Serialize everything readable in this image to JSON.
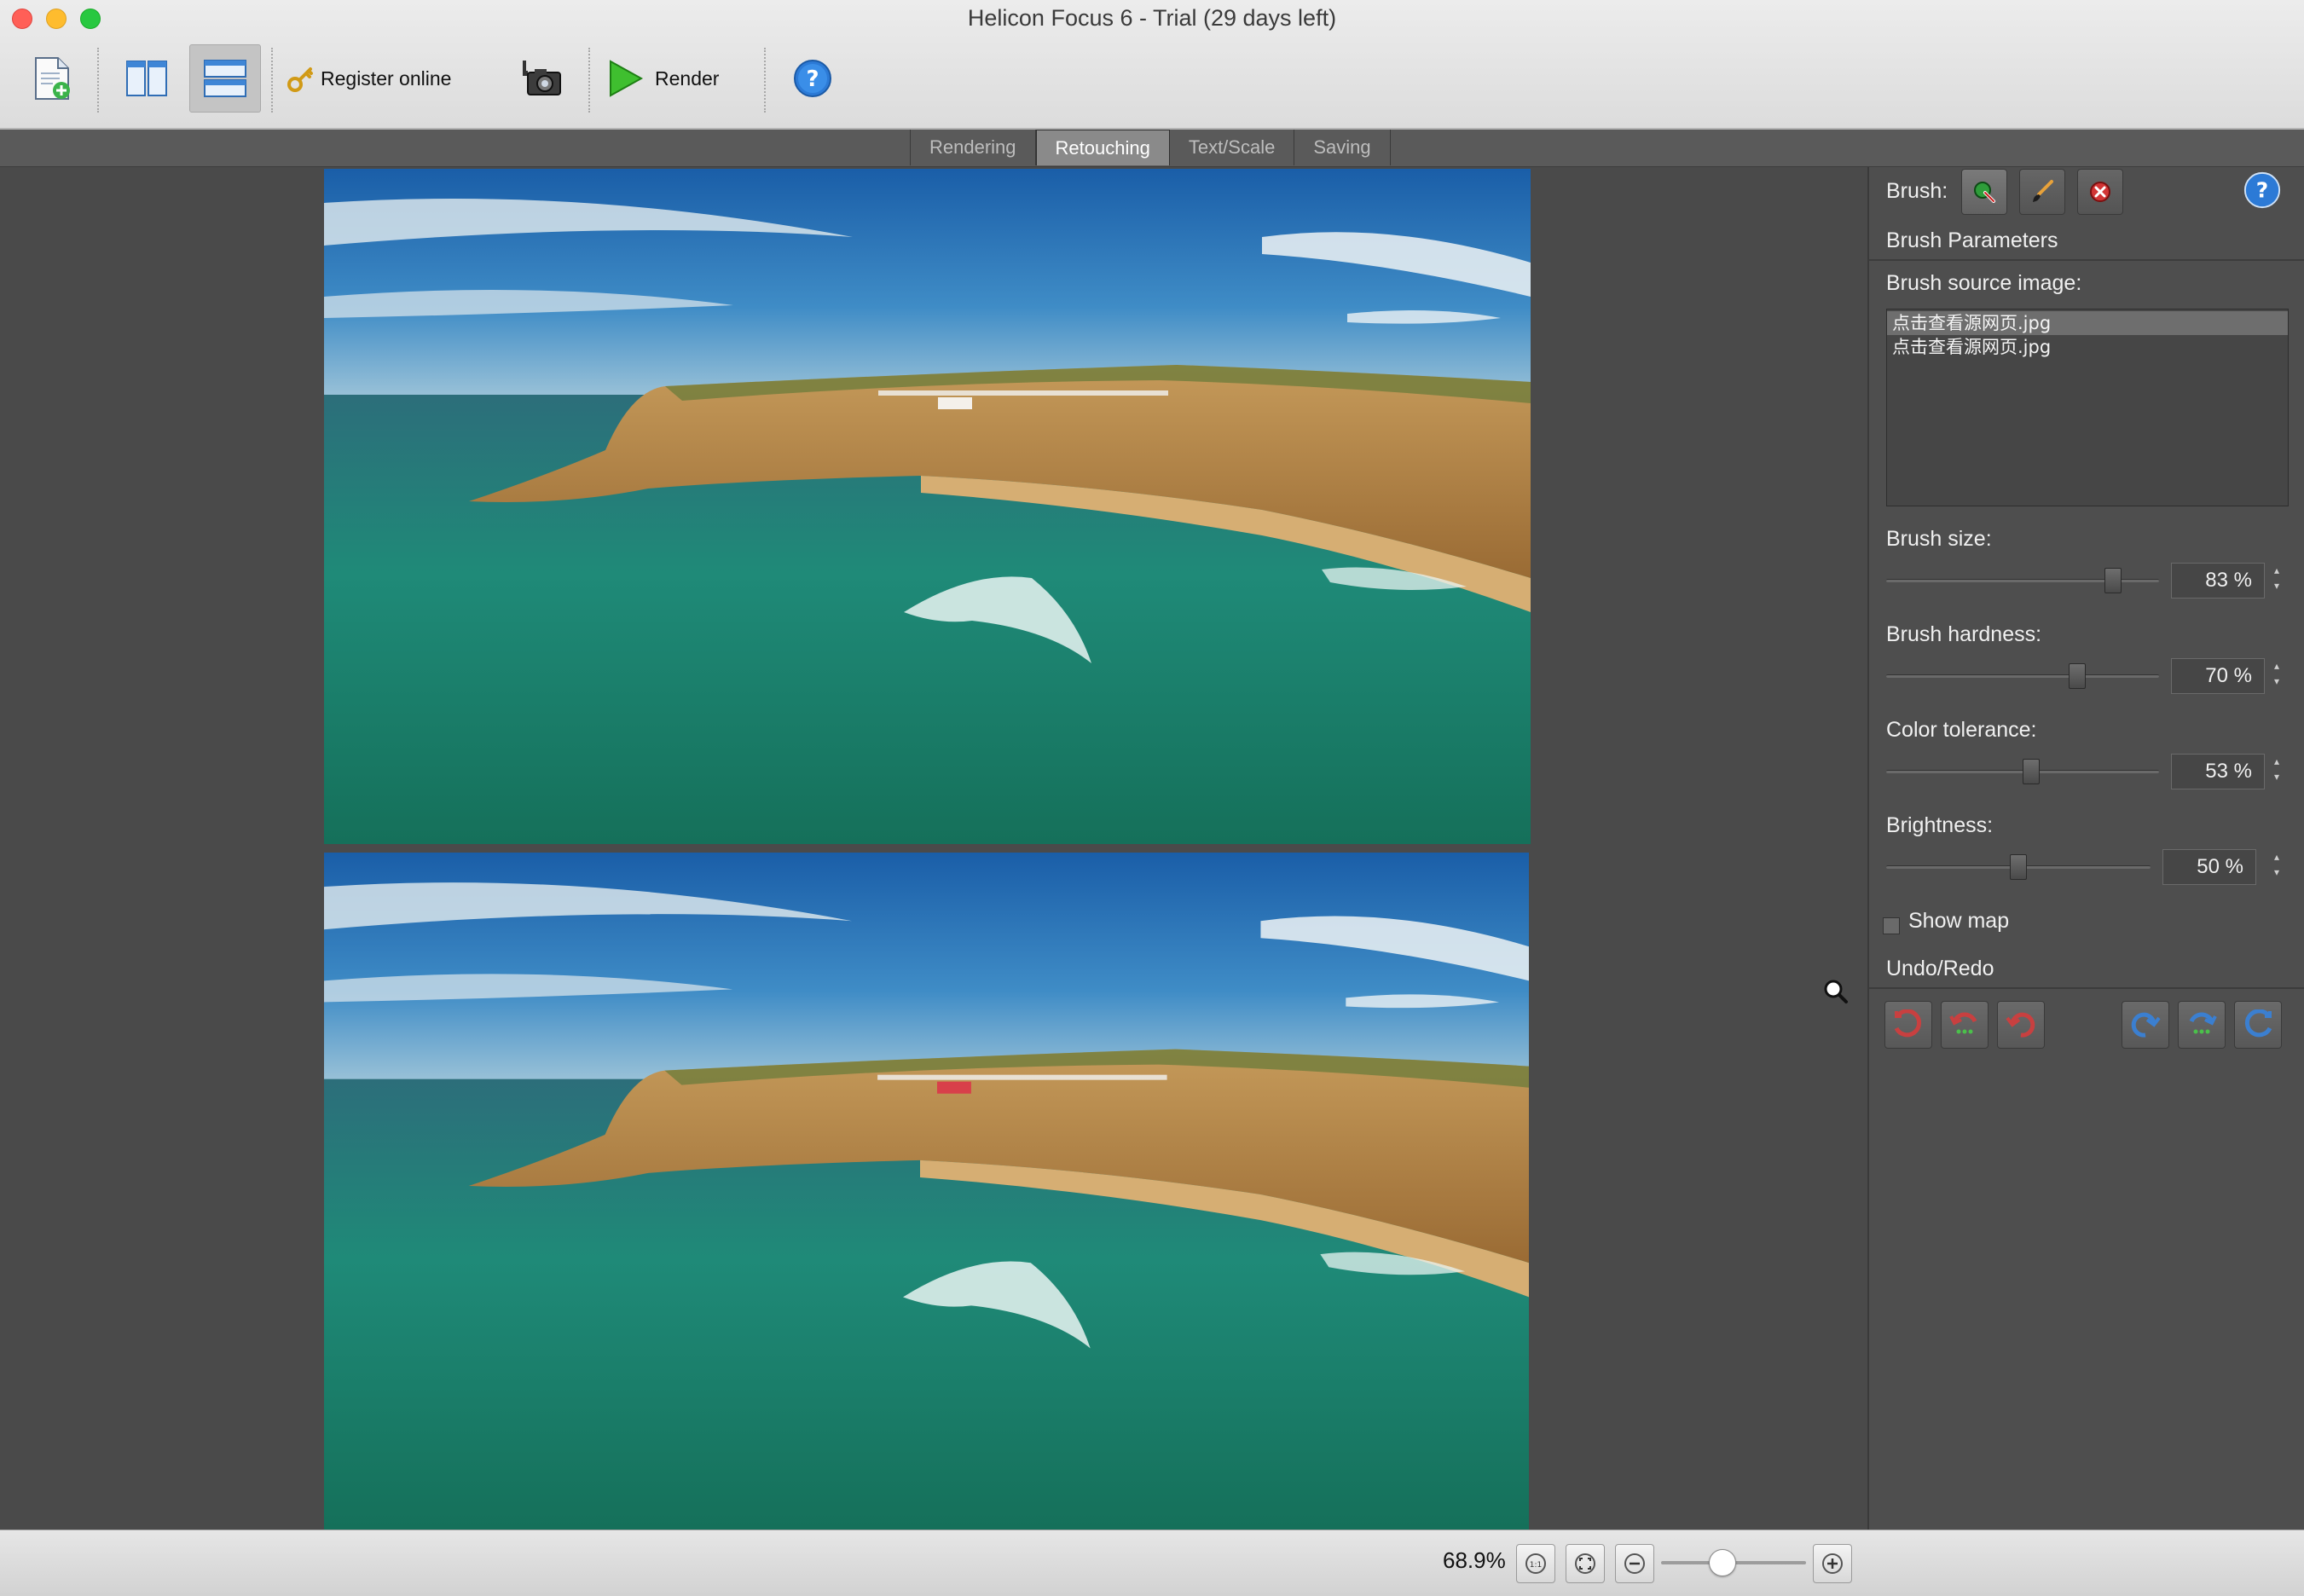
{
  "window": {
    "title": "Helicon Focus 6 - Trial (29 days left)"
  },
  "toolbar": {
    "register_label": "Register online",
    "render_label": "Render"
  },
  "tabs": [
    "Rendering",
    "Retouching",
    "Text/Scale",
    "Saving"
  ],
  "active_tab": "Retouching",
  "panel": {
    "brush_label": "Brush:",
    "brush_parameters": "Brush Parameters",
    "source_label": "Brush source image:",
    "source_images": [
      "点击查看源网页.jpg",
      "点击查看源网页.jpg"
    ],
    "brush_size": {
      "label": "Brush size:",
      "value": "83 %",
      "level": 0.83
    },
    "brush_hardness": {
      "label": "Brush hardness:",
      "value": "70 %",
      "level": 0.7
    },
    "color_tolerance": {
      "label": "Color tolerance:",
      "value": "53 %",
      "level": 0.53
    },
    "brightness": {
      "label": "Brightness:",
      "value": "50 %",
      "level": 0.5
    },
    "show_map": "Show map",
    "undo_redo": "Undo/Redo"
  },
  "status": {
    "zoom": "68.9%"
  },
  "colors": {
    "toolbar_bg": "#e0e0e0",
    "panel_bg": "#4e4e4e",
    "canvas_bg": "#4a4a4a",
    "active_tab": "#8a8a8a"
  }
}
